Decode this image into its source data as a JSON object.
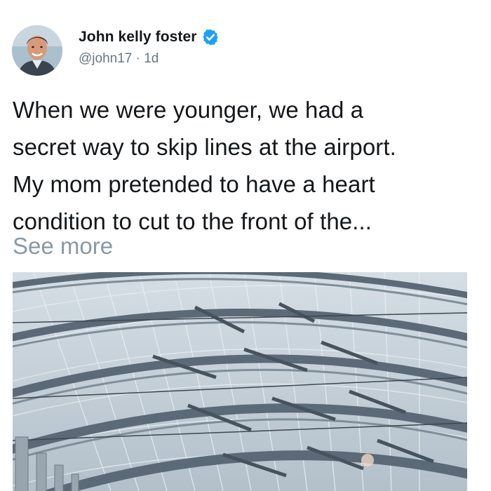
{
  "tweet": {
    "author": {
      "display_name": "John kelly foster",
      "verified": true,
      "handle": "@john17",
      "separator": "·",
      "time_ago": "1d",
      "avatar_icon": "profile-photo"
    },
    "text_lines": [
      "When we were younger, we had a",
      "secret way to skip lines at the airport.",
      "My mom pretended to have a heart",
      "condition to cut to the front of the..."
    ],
    "see_more_label": "See more",
    "media": {
      "icon": "airport-terminal-roof-photo"
    }
  },
  "colors": {
    "verified_badge": "#1da1f2",
    "secondary_text": "#657786",
    "see_more": "#8899a6"
  }
}
